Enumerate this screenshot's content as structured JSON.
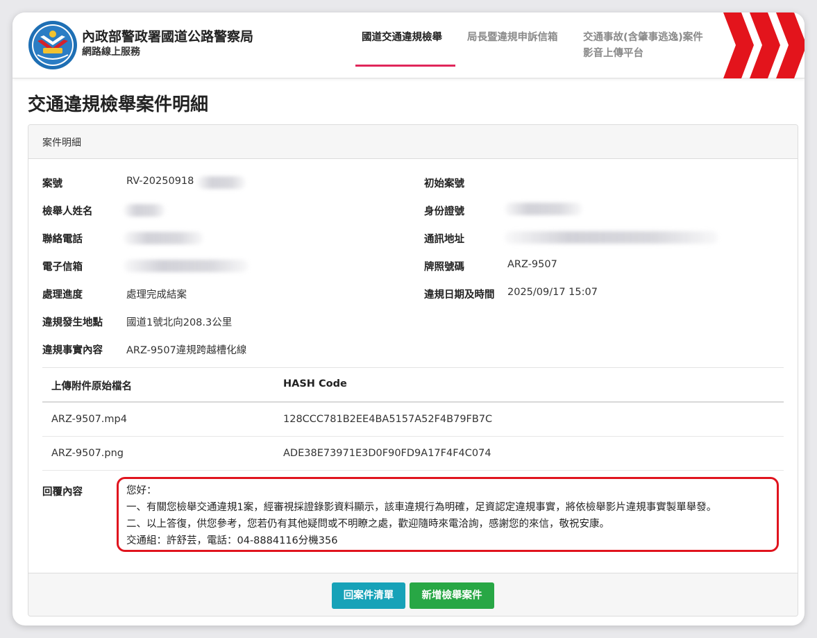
{
  "header": {
    "org_name": "內政部警政署國道公路警察局",
    "org_sub": "網路線上服務",
    "nav": [
      {
        "label": "國道交通違規檢舉",
        "active": true
      },
      {
        "label": "局長暨違規申訴信箱",
        "active": false
      },
      {
        "label_line1": "交通事故(含肇事逃逸)案件",
        "label_line2": "影音上傳平台",
        "active": false
      }
    ],
    "colors": {
      "accent": "#e0265a",
      "chevron": "#e3141c"
    }
  },
  "page": {
    "title": "交通違規檢舉案件明細"
  },
  "card": {
    "header": "案件明細",
    "fields": {
      "case_no": {
        "label": "案號",
        "value": "RV-20250918"
      },
      "original_case_no": {
        "label": "初始案號",
        "value": ""
      },
      "reporter_name": {
        "label": "檢舉人姓名",
        "value": ""
      },
      "id_number": {
        "label": "身份證號",
        "value": ""
      },
      "phone": {
        "label": "聯絡電話",
        "value": ""
      },
      "address": {
        "label": "通訊地址",
        "value": ""
      },
      "email": {
        "label": "電子信箱",
        "value": ""
      },
      "plate": {
        "label": "牌照號碼",
        "value": "ARZ-9507"
      },
      "status": {
        "label": "處理進度",
        "value": "處理完成結案"
      },
      "violation_datetime": {
        "label": "違規日期及時間",
        "value": "2025/09/17 15:07"
      },
      "location": {
        "label": "違規發生地點",
        "value": "國道1號北向208.3公里"
      },
      "content": {
        "label": "違規事實內容",
        "value": "ARZ-9507違規跨越槽化線"
      }
    },
    "attachments": {
      "col_name": "上傳附件原始檔名",
      "col_hash": "HASH Code",
      "rows": [
        {
          "name": "ARZ-9507.mp4",
          "hash": "128CCC781B2EE4BA5157A52F4B79FB7C"
        },
        {
          "name": "ARZ-9507.png",
          "hash": "ADE38E73971E3D0F90FD9A17F4F4C074"
        }
      ]
    },
    "reply": {
      "label": "回覆內容",
      "lines": [
        "您好：",
        "一、有關您檢舉交通違規1案，經審視採證錄影資料顯示，該車違規行為明確，足資認定違規事實，將依檢舉影片違規事實製單舉發。",
        "二、以上答復，供您參考，您若仍有其他疑問或不明瞭之處，歡迎隨時來電洽詢，感謝您的來信，敬祝安康。",
        "交通組：許舒芸，電話：04-8884116分機356"
      ]
    },
    "buttons": {
      "back": "回案件清單",
      "new": "新增檢舉案件"
    }
  }
}
